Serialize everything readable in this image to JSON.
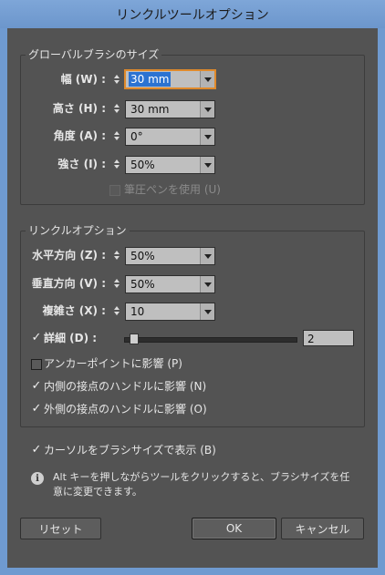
{
  "window": {
    "title": "リンクルツールオプション"
  },
  "brush_group": {
    "title": "グローバルブラシのサイズ",
    "width": {
      "label": "幅 (W) :",
      "value": "30 mm"
    },
    "height": {
      "label": "高さ (H) :",
      "value": "30 mm"
    },
    "angle": {
      "label": "角度 (A) :",
      "value": "0°"
    },
    "intensity": {
      "label": "強さ (I) :",
      "value": "50%"
    },
    "use_pressure_pen": {
      "label": "筆圧ペンを使用 (U)",
      "checked": false,
      "enabled": false
    }
  },
  "wrinkle_group": {
    "title": "リンクルオプション",
    "horizontal": {
      "label": "水平方向 (Z) :",
      "value": "50%"
    },
    "vertical": {
      "label": "垂直方向 (V) :",
      "value": "50%"
    },
    "complexity": {
      "label": "複雑さ (X) :",
      "value": "10"
    },
    "detail": {
      "label": "詳細 (D) :",
      "checked": true,
      "value": "2"
    },
    "affect_anchor": {
      "label": "アンカーポイントに影響 (P)",
      "checked": false
    },
    "affect_in_handles": {
      "label": "内側の接点のハンドルに影響 (N)",
      "checked": true
    },
    "affect_out_handles": {
      "label": "外側の接点のハンドルに影響 (O)",
      "checked": true
    }
  },
  "show_brush_size": {
    "label": "カーソルをブラシサイズで表示 (B)",
    "checked": true
  },
  "info_note": "Alt キーを押しながらツールをクリックすると、ブラシサイズを任意に変更できます。",
  "buttons": {
    "reset": "リセット",
    "ok": "OK",
    "cancel": "キャンセル"
  }
}
